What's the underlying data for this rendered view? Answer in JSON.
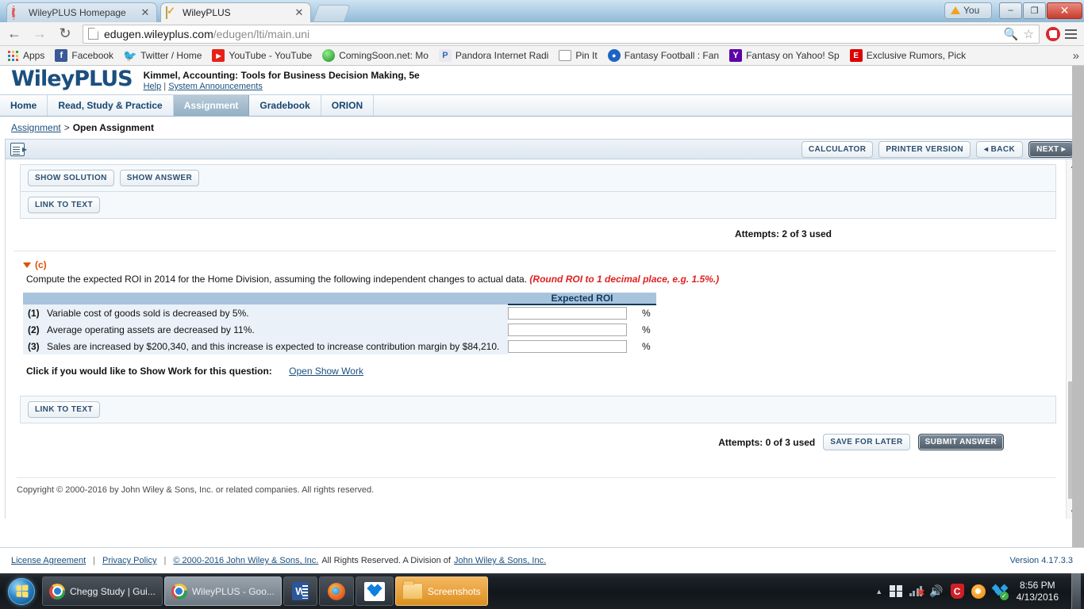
{
  "browser": {
    "tabs": [
      {
        "title": "WileyPLUS Homepage",
        "favicon": "loading-spinner-icon",
        "active": false
      },
      {
        "title": "WileyPLUS",
        "favicon": "wiley-check-icon",
        "active": true
      }
    ],
    "window_controls": {
      "profile_label": "You",
      "minimize": "–",
      "restore": "❐",
      "close": "✕"
    },
    "url_dark": "edugen.wileyplus.com",
    "url_grey": "/edugen/lti/main.uni",
    "bookmarks": [
      {
        "label": "Apps",
        "icon": "apps-grid-icon"
      },
      {
        "label": "Facebook",
        "icon": "facebook-icon"
      },
      {
        "label": "Twitter / Home",
        "icon": "twitter-icon"
      },
      {
        "label": "YouTube - YouTube",
        "icon": "youtube-icon"
      },
      {
        "label": "ComingSoon.net: Mo",
        "icon": "comingsoon-icon"
      },
      {
        "label": "Pandora Internet Radi",
        "icon": "pandora-icon"
      },
      {
        "label": "Pin It",
        "icon": "page-icon"
      },
      {
        "label": "Fantasy Football : Fan",
        "icon": "fantasy-football-icon"
      },
      {
        "label": "Fantasy on Yahoo! Sp",
        "icon": "yahoo-icon"
      },
      {
        "label": "Exclusive Rumors, Pick",
        "icon": "espn-icon"
      }
    ],
    "bookmarks_overflow": "»"
  },
  "wileyplus": {
    "logo": "WileyPLUS",
    "course_title": "Kimmel, Accounting: Tools for Business Decision Making, 5e",
    "help_link": "Help",
    "link_separator": "|",
    "announcements_link": "System Announcements",
    "nav_tabs": [
      {
        "label": "Home",
        "active": false
      },
      {
        "label": "Read, Study & Practice",
        "active": false
      },
      {
        "label": "Assignment",
        "active": true
      },
      {
        "label": "Gradebook",
        "active": false
      },
      {
        "label": "ORION",
        "active": false
      }
    ],
    "breadcrumb": {
      "root": "Assignment",
      "separator": ">",
      "current": "Open Assignment"
    },
    "toolbar": {
      "calculator": "CALCULATOR",
      "printer_version": "PRINTER VERSION",
      "back": "◂ BACK",
      "next": "NEXT ▸"
    },
    "upper_panel": {
      "show_solution": "SHOW SOLUTION",
      "show_answer": "SHOW ANSWER",
      "link_to_text": "LINK TO TEXT",
      "attempts": "Attempts: 2 of 3 used"
    },
    "question": {
      "part_label": "(c)",
      "prompt": "Compute the expected ROI in 2014 for the Home Division, assuming the following independent changes to actual data.",
      "rounding_note": "(Round ROI to 1 decimal place, e.g. 1.5%.)",
      "column_header": "Expected ROI",
      "percent_symbol": "%",
      "rows": [
        {
          "num": "(1)",
          "label": "Variable cost of goods sold is decreased by 5%.",
          "value": ""
        },
        {
          "num": "(2)",
          "label": "Average operating assets are decreased by 11%.",
          "value": ""
        },
        {
          "num": "(3)",
          "label": "Sales are increased by $200,340, and this increase is expected to increase contribution margin by $84,210.",
          "value": ""
        }
      ],
      "show_work_label": "Click if you would like to Show Work for this question:",
      "show_work_link": "Open Show Work"
    },
    "lower_panel": {
      "link_to_text": "LINK TO TEXT",
      "attempts": "Attempts: 0 of 3 used",
      "save_for_later": "SAVE FOR LATER",
      "submit_answer": "SUBMIT ANSWER"
    },
    "copyright_inner": "Copyright © 2000-2016 by John Wiley & Sons, Inc. or related companies. All rights reserved.",
    "footer": {
      "license": "License Agreement",
      "privacy": "Privacy Policy",
      "copyright_link": "© 2000-2016 John Wiley & Sons, Inc.",
      "rights_text": "All Rights Reserved. A Division of",
      "division_link": "John Wiley & Sons, Inc.",
      "divider": "|",
      "version": "Version 4.17.3.3"
    }
  },
  "taskbar": {
    "start": "start-orb-icon",
    "items": [
      {
        "label": "Chegg Study | Gui...",
        "icon": "chrome-icon",
        "lit": false
      },
      {
        "label": "WileyPLUS - Goo...",
        "icon": "chrome-icon",
        "lit": true
      },
      {
        "label": "",
        "icon": "word-icon",
        "lit": false
      },
      {
        "label": "",
        "icon": "firefox-icon",
        "lit": false
      },
      {
        "label": "",
        "icon": "dropbox-icon",
        "lit": false
      },
      {
        "label": "Screenshots",
        "icon": "folder-icon",
        "lit": false
      }
    ],
    "tray": {
      "overflow": "▲",
      "icons": [
        "windows-flag-icon",
        "network-disconnected-icon",
        "volume-icon",
        "comodo-shield-icon",
        "orange-circle-icon",
        "dropbox-sync-icon"
      ],
      "time": "8:56 PM",
      "date": "4/13/2016"
    }
  }
}
